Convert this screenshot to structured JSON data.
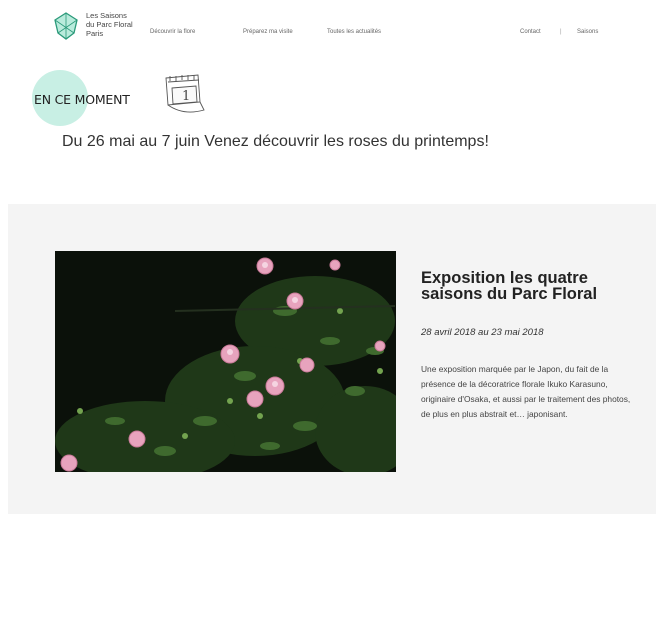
{
  "header": {
    "logo_lines": [
      "Les Saisons",
      "du Parc Floral",
      "Paris"
    ],
    "nav_items": [
      "Découvrir la flore",
      "Préparez ma visite",
      "Toutes les actualités"
    ],
    "nav_right": [
      "Contact",
      "Saisons"
    ]
  },
  "moment": {
    "label": "EN CE MOMENT",
    "headline": "Du 26 mai au 7 juin Venez découvrir les roses du printemps!"
  },
  "feature": {
    "title": "Exposition les quatre saisons du Parc Floral",
    "date": "28 avril 2018 au 23 mai 2018",
    "description": "Une exposition marquée par le Japon, du fait de la présence de la décoratrice florale Ikuko Karasuno, originaire d'Osaka, et aussi par le traitement des photos, de plus en plus abstrait et… japonisant."
  },
  "colors": {
    "accent_mint": "#c8efe4",
    "band_bg": "#f4f4f4",
    "rose_pink": "#e7a3bd"
  }
}
